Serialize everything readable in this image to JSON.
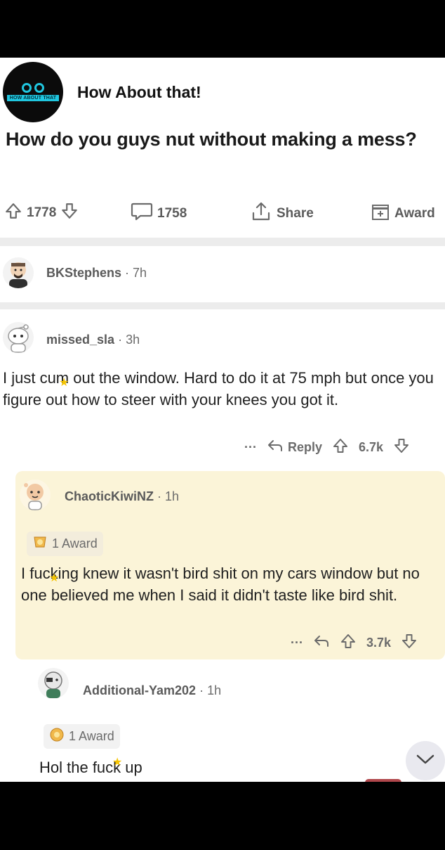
{
  "channel": {
    "name": "How About that!",
    "logo_text": "HOW ABOUT THAT"
  },
  "post": {
    "title": "How do you guys nut without making a mess?",
    "upvotes": "1778",
    "comments": "1758",
    "share_label": "Share",
    "award_label": "Award"
  },
  "comments": [
    {
      "user": "BKStephens",
      "sep": "·",
      "time": "7h"
    },
    {
      "user": "missed_sla",
      "sep": "·",
      "time": "3h",
      "text": "I just cum out the window. Hard to do it at 75 mph but once you figure out how to steer with your knees you got it.",
      "more": "···",
      "reply": "Reply",
      "score": "6.7k"
    },
    {
      "user": "ChaoticKiwiNZ",
      "sep": "·",
      "time": "1h",
      "award": "1 Award",
      "text": "I fucking knew it wasn't bird shit on my cars window but no one believed me when I said it didn't taste like bird shit.",
      "more": "···",
      "score": "3.7k"
    },
    {
      "user": "Additional-Yam202",
      "sep": "·",
      "time": "1h",
      "award": "1 Award",
      "text": "Hol the fuck up"
    }
  ],
  "colors": {
    "logo_accent": "#20c7e0",
    "highlight_bg": "#fbf4d8",
    "pill": "#b0474c"
  }
}
